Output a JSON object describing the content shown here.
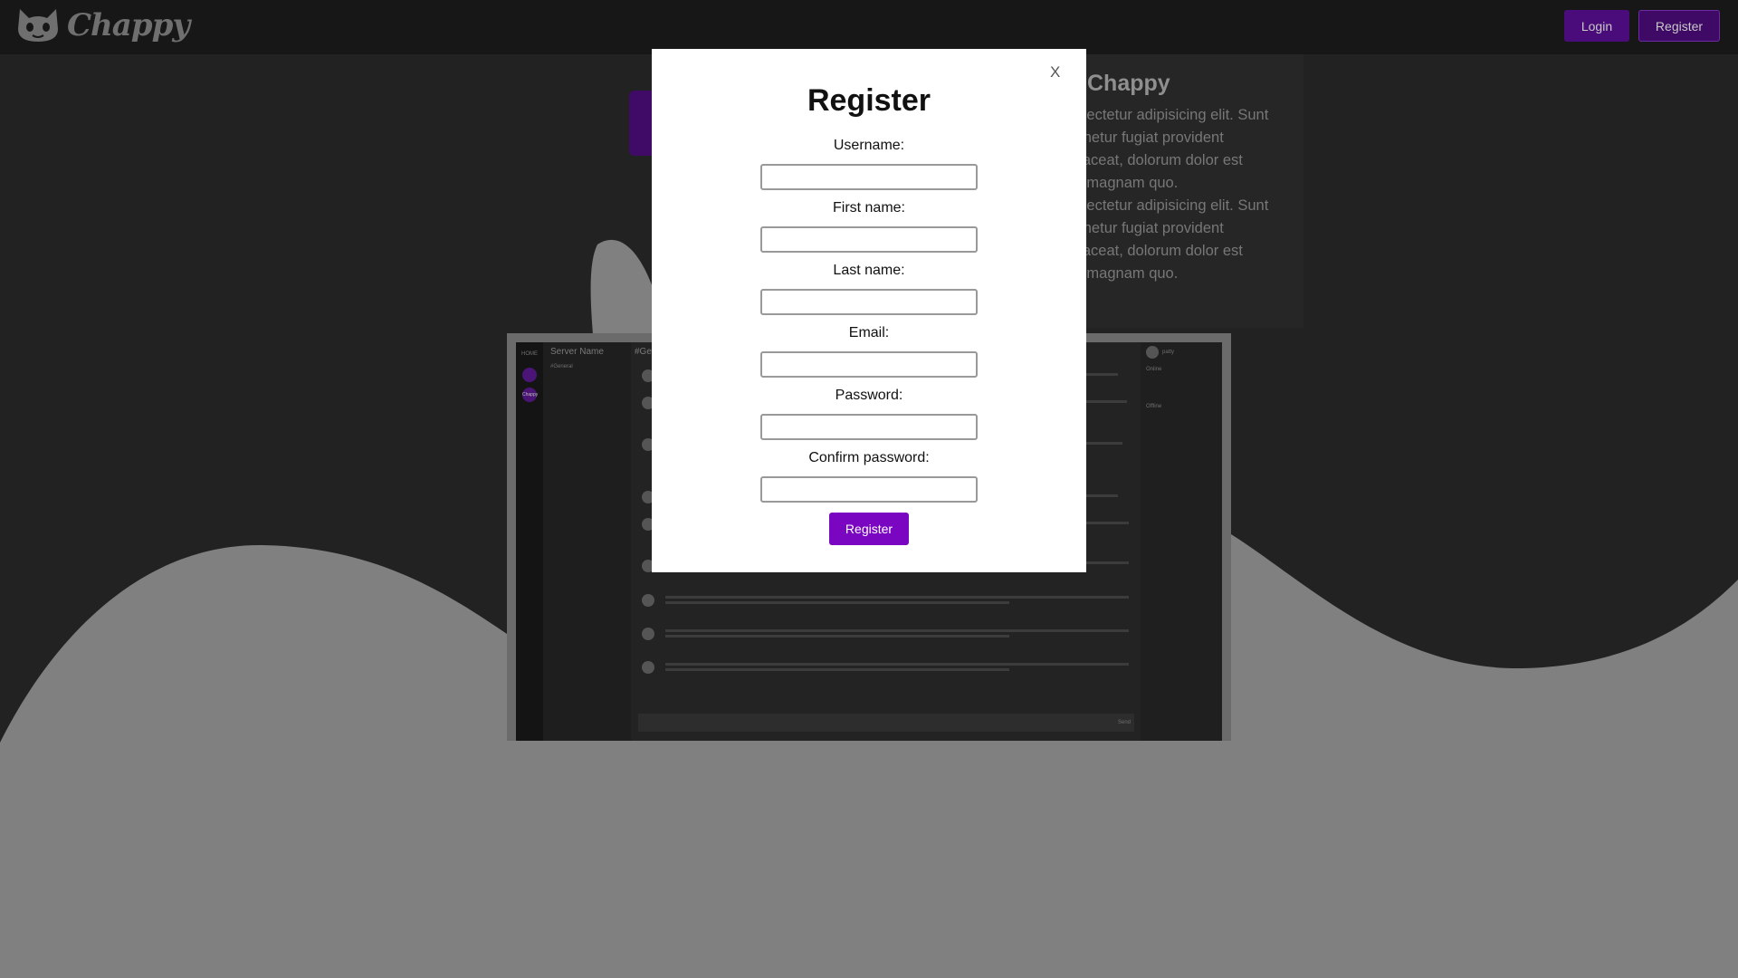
{
  "brand": {
    "name": "Chappy"
  },
  "nav": {
    "login_label": "Login",
    "register_label": "Register"
  },
  "hero": {
    "title": "Chappy",
    "text": "nsectetur adipisicing elit. Sunt\ntenetur fugiat provident\nplaceat, dolorum dolor est\nel magnam quo.\nnsectetur adipisicing elit. Sunt\ntenetur fugiat provident\nplaceat, dolorum dolor est\nel magnam quo."
  },
  "preview": {
    "home_label": "HOME",
    "server_name": "Server Name",
    "channel_label": "#Gen",
    "sidebar_channel": "#General",
    "rail_item": "Chappy",
    "member_name": "patty",
    "online_label": "Online",
    "offline_label": "Offline",
    "send_label": "Send"
  },
  "modal": {
    "close_label": "X",
    "title": "Register",
    "fields": [
      {
        "label": "Username:",
        "value": ""
      },
      {
        "label": "First name:",
        "value": ""
      },
      {
        "label": "Last name:",
        "value": ""
      },
      {
        "label": "Email:",
        "value": ""
      },
      {
        "label": "Password:",
        "value": ""
      },
      {
        "label": "Confirm password:",
        "value": ""
      }
    ],
    "submit_label": "Register"
  },
  "colors": {
    "accent": "#7a06c2",
    "nav_button": "#4a0c7a",
    "overlay_bg": "#808080",
    "topbar": "#171717"
  }
}
